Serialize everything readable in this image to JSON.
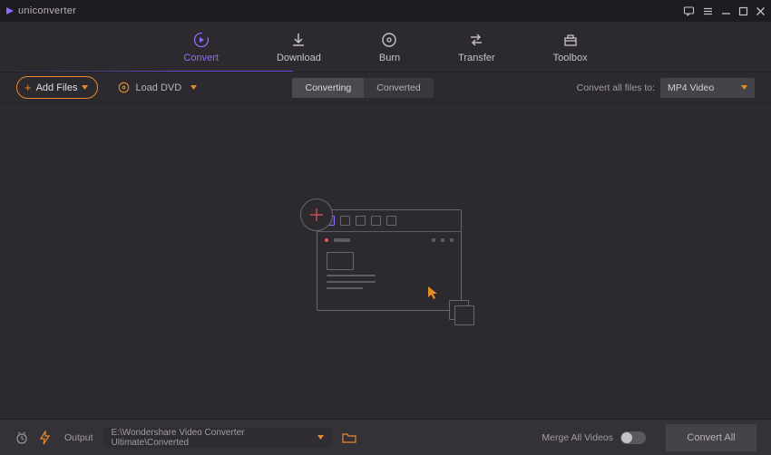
{
  "app": {
    "name": "uniconverter"
  },
  "tabs": [
    {
      "label": "Convert",
      "active": true
    },
    {
      "label": "Download",
      "active": false
    },
    {
      "label": "Burn",
      "active": false
    },
    {
      "label": "Transfer",
      "active": false
    },
    {
      "label": "Toolbox",
      "active": false
    }
  ],
  "subbar": {
    "addFiles": "Add Files",
    "loadDvd": "Load DVD",
    "segment": {
      "converting": "Converting",
      "converted": "Converted"
    },
    "convertAllLabel": "Convert all files to:",
    "format": "MP4 Video"
  },
  "footer": {
    "outputLabel": "Output",
    "outputPath": "E:\\Wondershare Video Converter Ultimate\\Converted",
    "mergeLabel": "Merge All Videos",
    "convertAll": "Convert All"
  }
}
